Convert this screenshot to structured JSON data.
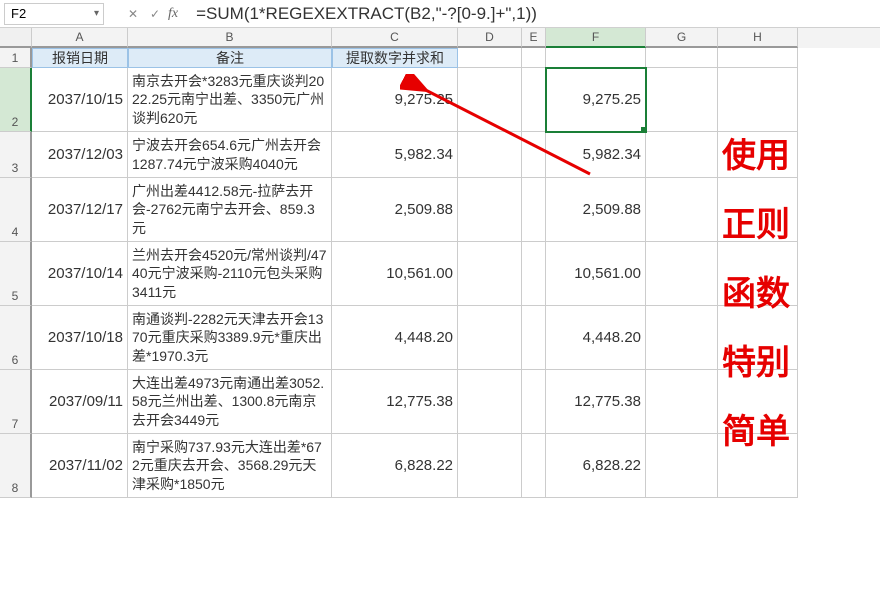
{
  "namebox": {
    "value": "F2"
  },
  "formula_bar": {
    "value": "=SUM(1*REGEXEXTRACT(B2,\"-?[0-9.]+\",1))"
  },
  "columns": [
    "A",
    "B",
    "C",
    "D",
    "E",
    "F",
    "G",
    "H"
  ],
  "selected_col_index": 5,
  "headers": {
    "a": "报销日期",
    "b": "备注",
    "c": "提取数字并求和"
  },
  "rows": [
    {
      "n": 2,
      "date": "2037/10/15",
      "note": "南京去开会*3283元重庆谈判2022.25元南宁出差、3350元广州谈判620元",
      "sum_c": "9,275.25",
      "sum_f": "9,275.25",
      "h": "h-tall"
    },
    {
      "n": 3,
      "date": "2037/12/03",
      "note": "宁波去开会654.6元广州去开会1287.74元宁波采购4040元",
      "sum_c": "5,982.34",
      "sum_f": "5,982.34",
      "h": "h-med"
    },
    {
      "n": 4,
      "date": "2037/12/17",
      "note": "广州出差4412.58元-拉萨去开会-2762元南宁去开会、859.3元",
      "sum_c": "2,509.88",
      "sum_f": "2,509.88",
      "h": "h-tall"
    },
    {
      "n": 5,
      "date": "2037/10/14",
      "note": "兰州去开会4520元/常州谈判/4740元宁波采购-2110元包头采购3411元",
      "sum_c": "10,561.00",
      "sum_f": "10,561.00",
      "h": "h-tall"
    },
    {
      "n": 6,
      "date": "2037/10/18",
      "note": "南通谈判-2282元天津去开会1370元重庆采购3389.9元*重庆出差*1970.3元",
      "sum_c": "4,448.20",
      "sum_f": "4,448.20",
      "h": "h-tall"
    },
    {
      "n": 7,
      "date": "2037/09/11",
      "note": "大连出差4973元南通出差3052.58元兰州出差、1300.8元南京去开会3449元",
      "sum_c": "12,775.38",
      "sum_f": "12,775.38",
      "h": "h-tall"
    },
    {
      "n": 8,
      "date": "2037/11/02",
      "note": "南宁采购737.93元大连出差*672元重庆去开会、3568.29元天津采购*1850元",
      "sum_c": "6,828.22",
      "sum_f": "6,828.22",
      "h": "h-tall"
    }
  ],
  "selected_row": 2,
  "side_text": [
    "使用",
    "正则",
    "函数",
    "特别",
    "简单"
  ],
  "arrow_color": "#e60000"
}
